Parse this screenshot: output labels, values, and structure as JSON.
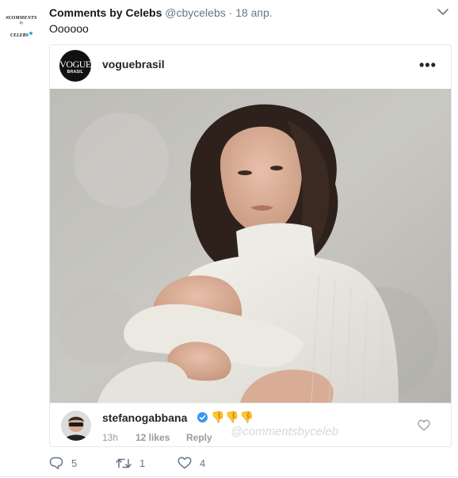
{
  "author": {
    "avatar_line1": "#COMMENTS",
    "avatar_line2": "by",
    "avatar_line3": "CELEBS",
    "name": "Comments by Celebs",
    "handle": "@cbycelebs",
    "separator": "·",
    "date": "18 апр."
  },
  "tweet_text": "Oooooo",
  "instagram": {
    "account_logo_line1": "VOGUE",
    "account_logo_line2": "BRASIL",
    "username": "voguebrasil",
    "more_label": "•••"
  },
  "comment": {
    "username": "stefanogabbana",
    "emoji": "👎👎👎",
    "time": "13h",
    "likes": "12 likes",
    "reply_label": "Reply",
    "watermark": "@commentsbyceleb"
  },
  "actions": {
    "replies": "5",
    "retweets": "1",
    "likes": "4"
  },
  "colors": {
    "twitter_gray": "#657786",
    "verified_blue": "#3897f0",
    "ig_text": "#262626"
  }
}
